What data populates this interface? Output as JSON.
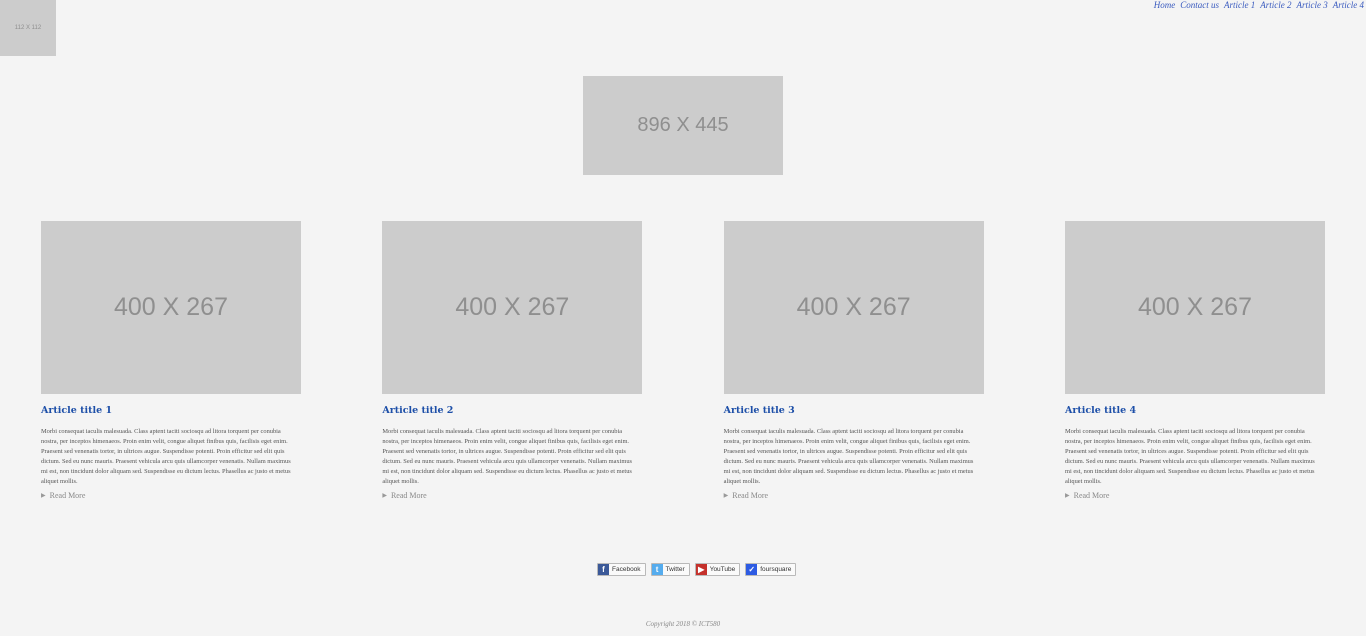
{
  "logo": {
    "label": "112 X 112"
  },
  "nav": {
    "items": [
      "Home",
      "Contact us",
      "Article 1",
      "Article 2",
      "Article 3",
      "Article 4"
    ]
  },
  "hero": {
    "label": "896 X 445"
  },
  "articles": [
    {
      "image_label": "400 X 267",
      "title": "Article title 1",
      "body": "Morbi consequat iaculis malesuada. Class aptent taciti sociosqu ad litora torquent per conubia nostra, per inceptos himenaeos. Proin enim velit, congue aliquet finibus quis, facilisis eget enim. Praesent sed venenatis tortor, in ultrices augue. Suspendisse potenti. Proin efficitur sed elit quis dictum. Sed eu nunc mauris. Praesent vehicula arcu quis ullamcorper venenatis. Nullam maximus mi est, non tincidunt dolor aliquam sed. Suspendisse eu dictum lectus. Phasellus ac justo et metus aliquet mollis.",
      "read_more": "Read More"
    },
    {
      "image_label": "400 X 267",
      "title": "Article title 2",
      "body": "Morbi consequat iaculis malesuada. Class aptent taciti sociosqu ad litora torquent per conubia nostra, per inceptos himenaeos. Proin enim velit, congue aliquet finibus quis, facilisis eget enim. Praesent sed venenatis tortor, in ultrices augue. Suspendisse potenti. Proin efficitur sed elit quis dictum. Sed eu nunc mauris. Praesent vehicula arcu quis ullamcorper venenatis. Nullam maximus mi est, non tincidunt dolor aliquam sed. Suspendisse eu dictum lectus. Phasellus ac justo et metus aliquet mollis.",
      "read_more": "Read More"
    },
    {
      "image_label": "400 X 267",
      "title": "Article title 3",
      "body": "Morbi consequat iaculis malesuada. Class aptent taciti sociosqu ad litora torquent per conubia nostra, per inceptos himenaeos. Proin enim velit, congue aliquet finibus quis, facilisis eget enim. Praesent sed venenatis tortor, in ultrices augue. Suspendisse potenti. Proin efficitur sed elit quis dictum. Sed eu nunc mauris. Praesent vehicula arcu quis ullamcorper venenatis. Nullam maximus mi est, non tincidunt dolor aliquam sed. Suspendisse eu dictum lectus. Phasellus ac justo et metus aliquet mollis.",
      "read_more": "Read More"
    },
    {
      "image_label": "400 X 267",
      "title": "Article title 4",
      "body": "Morbi consequat iaculis malesuada. Class aptent taciti sociosqu ad litora torquent per conubia nostra, per inceptos himenaeos. Proin enim velit, congue aliquet finibus quis, facilisis eget enim. Praesent sed venenatis tortor, in ultrices augue. Suspendisse potenti. Proin efficitur sed elit quis dictum. Sed eu nunc mauris. Praesent vehicula arcu quis ullamcorper venenatis. Nullam maximus mi est, non tincidunt dolor aliquam sed. Suspendisse eu dictum lectus. Phasellus ac justo et metus aliquet mollis.",
      "read_more": "Read More"
    }
  ],
  "social": [
    {
      "label": "Facebook",
      "icon": "facebook-icon",
      "glyph": "f",
      "color": "#3b5998"
    },
    {
      "label": "Twitter",
      "icon": "twitter-icon",
      "glyph": "t",
      "color": "#55acee"
    },
    {
      "label": "YouTube",
      "icon": "youtube-icon",
      "glyph": "▶",
      "color": "#c4302b"
    },
    {
      "label": "foursquare",
      "icon": "foursquare-icon",
      "glyph": "✓",
      "color": "#2d5be3"
    }
  ],
  "footer": {
    "copyright": "Copyright 2018 © ICT580"
  },
  "colors": {
    "background": "#f4f4f4",
    "placeholder": "#cccccc",
    "link": "#3a5bbf",
    "title": "#1d4fa8"
  }
}
